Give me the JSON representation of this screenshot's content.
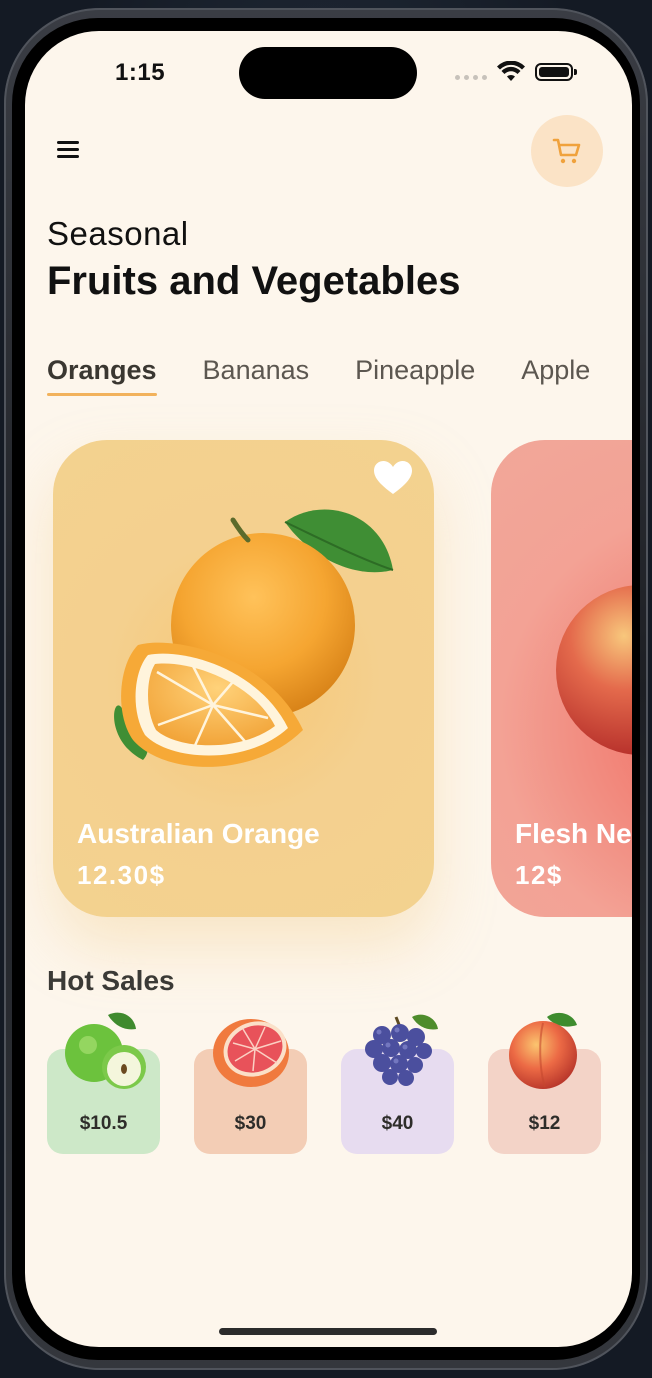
{
  "status_bar": {
    "time": "1:15"
  },
  "header": {
    "subtitle": "Seasonal",
    "title": "Fruits and Vegetables"
  },
  "tabs": [
    {
      "label": "Oranges",
      "active": true
    },
    {
      "label": "Bananas",
      "active": false
    },
    {
      "label": "Pineapple",
      "active": false
    },
    {
      "label": "Apple",
      "active": false
    }
  ],
  "cards": [
    {
      "name": "Australian Orange",
      "price": "12.30$",
      "color": "#f4cf86",
      "favorite": true
    },
    {
      "name": "Flesh Nectarine",
      "price": "12$",
      "color": "#f19a8c"
    }
  ],
  "hot_sales": {
    "title": "Hot Sales",
    "items": [
      {
        "fruit": "green apple",
        "price": "$10.5",
        "color": "#cde8c8"
      },
      {
        "fruit": "grapefruit",
        "price": "$30",
        "color": "#f3cdb5"
      },
      {
        "fruit": "grapes",
        "price": "$40",
        "color": "#e7dcf0"
      },
      {
        "fruit": "peach",
        "price": "$12",
        "color": "#f3d3c7"
      }
    ]
  },
  "colors": {
    "background": "#fdf6ec",
    "accent": "#f2b25c",
    "cart_bg": "#fbe3c6"
  },
  "icons": [
    "menu-icon",
    "cart-icon",
    "heart-icon",
    "wifi-icon",
    "battery-icon"
  ]
}
